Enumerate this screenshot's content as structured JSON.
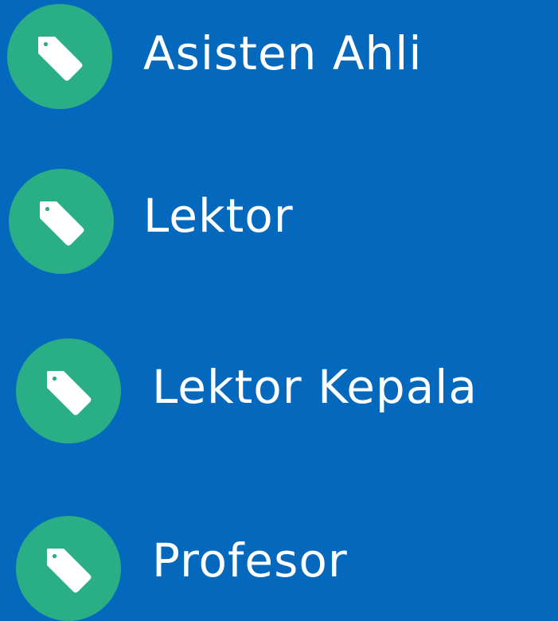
{
  "colors": {
    "background": "#0469BC",
    "badge": "#2AAE86",
    "icon": "#FFFFFF",
    "text": "#FFFFFF"
  },
  "items": [
    {
      "label": "Asisten Ahli",
      "icon": "tag-icon"
    },
    {
      "label": "Lektor",
      "icon": "tag-icon"
    },
    {
      "label": "Lektor Kepala",
      "icon": "tag-icon"
    },
    {
      "label": "Profesor",
      "icon": "tag-icon"
    }
  ]
}
